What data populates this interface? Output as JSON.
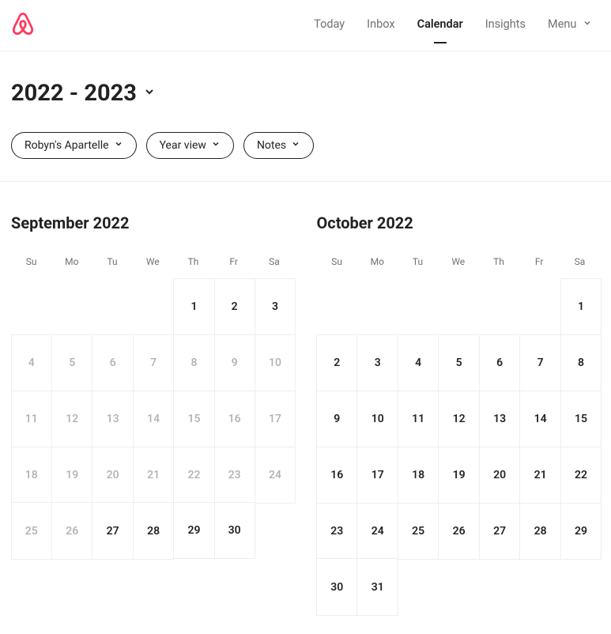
{
  "brand": {
    "color": "#FF385C"
  },
  "nav": {
    "today": "Today",
    "inbox": "Inbox",
    "calendar": "Calendar",
    "insights": "Insights",
    "menu": "Menu"
  },
  "title": "2022 - 2023",
  "chips": {
    "listing": "Robyn's Apartelle",
    "view": "Year view",
    "notes": "Notes"
  },
  "dow": [
    "Su",
    "Mo",
    "Tu",
    "We",
    "Th",
    "Fr",
    "Sa"
  ],
  "months": [
    {
      "title": "September 2022",
      "offset": 4,
      "days": [
        {
          "n": 1,
          "past": false
        },
        {
          "n": 2,
          "past": false
        },
        {
          "n": 3,
          "past": false
        },
        {
          "n": 4,
          "past": true
        },
        {
          "n": 5,
          "past": true
        },
        {
          "n": 6,
          "past": true
        },
        {
          "n": 7,
          "past": true
        },
        {
          "n": 8,
          "past": true
        },
        {
          "n": 9,
          "past": true
        },
        {
          "n": 10,
          "past": true
        },
        {
          "n": 11,
          "past": true
        },
        {
          "n": 12,
          "past": true
        },
        {
          "n": 13,
          "past": true
        },
        {
          "n": 14,
          "past": true
        },
        {
          "n": 15,
          "past": true
        },
        {
          "n": 16,
          "past": true
        },
        {
          "n": 17,
          "past": true
        },
        {
          "n": 18,
          "past": true
        },
        {
          "n": 19,
          "past": true
        },
        {
          "n": 20,
          "past": true
        },
        {
          "n": 21,
          "past": true
        },
        {
          "n": 22,
          "past": true
        },
        {
          "n": 23,
          "past": true
        },
        {
          "n": 24,
          "past": true
        },
        {
          "n": 25,
          "past": true
        },
        {
          "n": 26,
          "past": true
        },
        {
          "n": 27,
          "past": false
        },
        {
          "n": 28,
          "past": false
        },
        {
          "n": 29,
          "past": false
        },
        {
          "n": 30,
          "past": false
        }
      ]
    },
    {
      "title": "October 2022",
      "offset": 6,
      "days": [
        {
          "n": 1,
          "past": false
        },
        {
          "n": 2,
          "past": false
        },
        {
          "n": 3,
          "past": false
        },
        {
          "n": 4,
          "past": false
        },
        {
          "n": 5,
          "past": false
        },
        {
          "n": 6,
          "past": false
        },
        {
          "n": 7,
          "past": false
        },
        {
          "n": 8,
          "past": false
        },
        {
          "n": 9,
          "past": false
        },
        {
          "n": 10,
          "past": false
        },
        {
          "n": 11,
          "past": false
        },
        {
          "n": 12,
          "past": false
        },
        {
          "n": 13,
          "past": false
        },
        {
          "n": 14,
          "past": false
        },
        {
          "n": 15,
          "past": false
        },
        {
          "n": 16,
          "past": false
        },
        {
          "n": 17,
          "past": false
        },
        {
          "n": 18,
          "past": false
        },
        {
          "n": 19,
          "past": false
        },
        {
          "n": 20,
          "past": false
        },
        {
          "n": 21,
          "past": false
        },
        {
          "n": 22,
          "past": false
        },
        {
          "n": 23,
          "past": false
        },
        {
          "n": 24,
          "past": false
        },
        {
          "n": 25,
          "past": false
        },
        {
          "n": 26,
          "past": false
        },
        {
          "n": 27,
          "past": false
        },
        {
          "n": 28,
          "past": false
        },
        {
          "n": 29,
          "past": false
        },
        {
          "n": 30,
          "past": false
        },
        {
          "n": 31,
          "past": false
        }
      ]
    }
  ]
}
